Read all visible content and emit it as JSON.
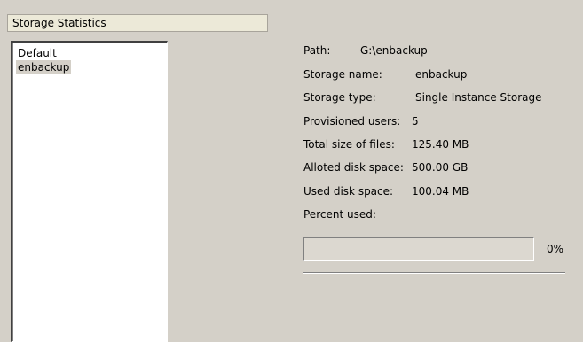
{
  "header": {
    "title": "Storage Statistics"
  },
  "storage_list": {
    "items": [
      {
        "label": "Default",
        "selected": false
      },
      {
        "label": "enbackup",
        "selected": true
      }
    ]
  },
  "details": {
    "path": {
      "label": "Path:",
      "value": "G:\\enbackup"
    },
    "storage_name": {
      "label": "Storage name:",
      "value": "enbackup"
    },
    "storage_type": {
      "label": "Storage type:",
      "value": "Single Instance Storage"
    },
    "provisioned_users": {
      "label": "Provisioned users:",
      "value": "5"
    },
    "total_size": {
      "label": "Total size of files:",
      "value": "125.40 MB"
    },
    "alloted_space": {
      "label": "Alloted disk space:",
      "value": "500.00 GB"
    },
    "used_space": {
      "label": "Used disk space:",
      "value": "100.04 MB"
    },
    "percent_used": {
      "label": "Percent used:",
      "value": "0%",
      "fraction": 0
    }
  }
}
